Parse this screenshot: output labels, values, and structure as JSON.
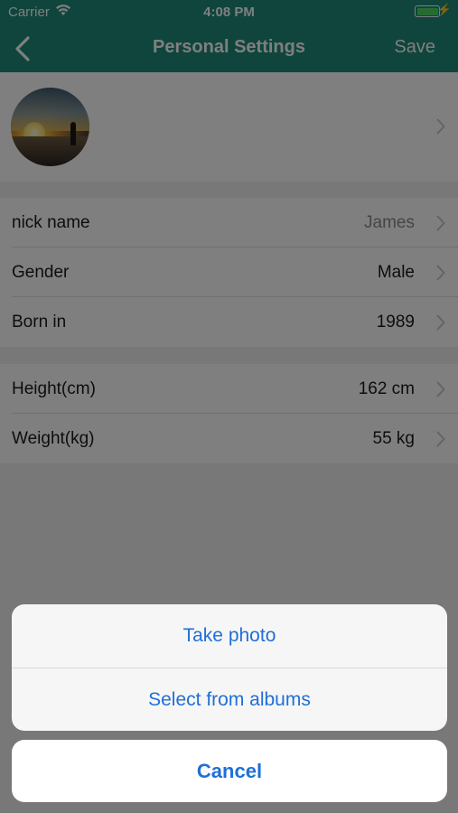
{
  "status_bar": {
    "carrier": "Carrier",
    "time": "4:08 PM"
  },
  "nav": {
    "title": "Personal Settings",
    "save_label": "Save",
    "back_icon": "chevron-left-icon"
  },
  "profile": {
    "avatar_description_icon": "avatar"
  },
  "basic_info": [
    {
      "label": "nick name",
      "value": "James",
      "muted": true
    },
    {
      "label": "Gender",
      "value": "Male",
      "muted": false
    },
    {
      "label": "Born in",
      "value": "1989",
      "muted": false
    }
  ],
  "body_info": [
    {
      "label": "Height(cm)",
      "value": "162 cm"
    },
    {
      "label": "Weight(kg)",
      "value": "55 kg"
    }
  ],
  "action_sheet": {
    "options": [
      "Take photo",
      "Select from albums"
    ],
    "cancel_label": "Cancel"
  },
  "colors": {
    "accent": "#1e8a79",
    "action": "#1f6fd8"
  }
}
